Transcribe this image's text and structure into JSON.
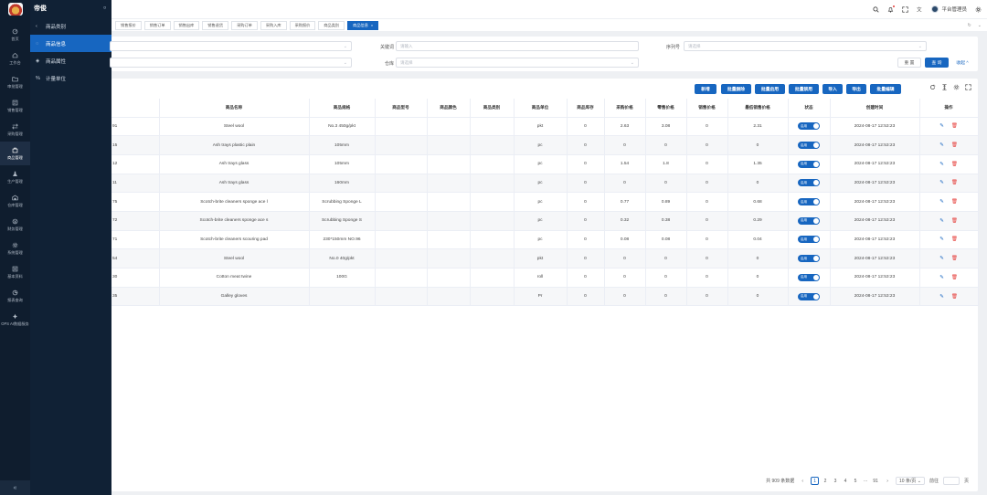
{
  "app": {
    "name": "帝俊",
    "pin": "¤"
  },
  "rail": {
    "items": [
      {
        "label": "首页",
        "icon": "dashboard-icon"
      },
      {
        "label": "工作台",
        "icon": "home-icon"
      },
      {
        "label": "审批管理",
        "icon": "folder-icon"
      },
      {
        "label": "销售管理",
        "icon": "sales-icon"
      },
      {
        "label": "采购管理",
        "icon": "purchase-icon"
      },
      {
        "label": "商品管理",
        "icon": "box-icon"
      },
      {
        "label": "生产管理",
        "icon": "flask-icon"
      },
      {
        "label": "仓库管理",
        "icon": "warehouse-icon"
      },
      {
        "label": "财务管理",
        "icon": "finance-icon"
      },
      {
        "label": "系统管理",
        "icon": "gear-icon"
      },
      {
        "label": "基本资料",
        "icon": "list-icon"
      },
      {
        "label": "报表查询",
        "icon": "report-icon"
      },
      {
        "label": "OPS AI数据服务",
        "icon": "ai-icon"
      }
    ],
    "collapse": "«"
  },
  "submenu": {
    "items": [
      {
        "label": "商品类别",
        "icon": "‹"
      },
      {
        "label": "商品信息",
        "icon": "◌"
      },
      {
        "label": "商品属性",
        "icon": "◈"
      },
      {
        "label": "计量单位",
        "icon": "%"
      }
    ]
  },
  "topbar": {
    "user": "平台管理员"
  },
  "tabs": {
    "items": [
      "销售报价",
      "销售订单",
      "销售出库",
      "销售退货",
      "采购订单",
      "采购入库",
      "采购报价",
      "商品类别",
      "商品信息"
    ],
    "close": "×",
    "refresh": "↻",
    "more": "⌄"
  },
  "filter": {
    "keyword_label": "关键词",
    "keyword_placeholder": "请输入",
    "serial_label": "序列号",
    "serial_placeholder": "请选择",
    "warehouse_label": "仓库",
    "warehouse_placeholder": "请选择",
    "reset": "重 置",
    "query": "查 询",
    "collapse": "收起 ^"
  },
  "toolbar": {
    "buttons": [
      "新增",
      "批量删除",
      "批量启用",
      "批量禁用",
      "导入",
      "导出",
      "批量编辑"
    ]
  },
  "table": {
    "headers": [
      "商品名称",
      "商品规格",
      "商品型号",
      "商品颜色",
      "商品类别",
      "商品单位",
      "商品库存",
      "采购价格",
      "零售价格",
      "销售价格",
      "最低销售价格",
      "状态",
      "创建时间",
      "操作"
    ],
    "status_label": "启用",
    "rows": [
      {
        "code": "91",
        "name": "Steel wool",
        "spec": "No.3 450g/pkt",
        "unit": "pkt",
        "stock": "0",
        "purchase": "2.63",
        "retail": "3.08",
        "sale": "0",
        "min": "2.31",
        "created": "2024-08-17 12:53:23"
      },
      {
        "code": "15",
        "name": "Ash trays plastic plain",
        "spec": "105mm",
        "unit": "pc",
        "stock": "0",
        "purchase": "0",
        "retail": "0",
        "sale": "0",
        "min": "0",
        "created": "2024-08-17 12:53:23"
      },
      {
        "code": "12",
        "name": "Ash trays glass",
        "spec": "105mm",
        "unit": "pc",
        "stock": "0",
        "purchase": "1.54",
        "retail": "1.8",
        "sale": "0",
        "min": "1.35",
        "created": "2024-08-17 12:53:23"
      },
      {
        "code": "11",
        "name": "Ash trays glass",
        "spec": "160mm",
        "unit": "pc",
        "stock": "0",
        "purchase": "0",
        "retail": "0",
        "sale": "0",
        "min": "0",
        "created": "2024-08-17 12:53:23"
      },
      {
        "code": "75",
        "name": "Scotch-brite cleaners sponge ace l",
        "spec": "Scrubbing Sponge L",
        "unit": "pc",
        "stock": "0",
        "purchase": "0.77",
        "retail": "0.89",
        "sale": "0",
        "min": "0.68",
        "created": "2024-08-17 12:53:23"
      },
      {
        "code": "72",
        "name": "Scotch-brite cleaners sponge ace s",
        "spec": "Scrubbing Sponge S",
        "unit": "pc",
        "stock": "0",
        "purchase": "0.32",
        "retail": "0.38",
        "sale": "0",
        "min": "0.29",
        "created": "2024-08-17 12:53:23"
      },
      {
        "code": "71",
        "name": "Scotch-brite cleaners scouring pad",
        "spec": "230*150mm NO.96",
        "unit": "pc",
        "stock": "0",
        "purchase": "0.08",
        "retail": "0.08",
        "sale": "0",
        "min": "0.04",
        "created": "2024-08-17 12:53:23"
      },
      {
        "code": "54",
        "name": "Steel wool",
        "spec": "No.0 40g/pkt",
        "unit": "pkt",
        "stock": "0",
        "purchase": "0",
        "retail": "0",
        "sale": "0",
        "min": "0",
        "created": "2024-08-17 12:53:23"
      },
      {
        "code": "30",
        "name": "Cotton meat twine",
        "spec": "100G",
        "unit": "roll",
        "stock": "0",
        "purchase": "0",
        "retail": "0",
        "sale": "0",
        "min": "0",
        "created": "2024-08-17 12:53:23"
      },
      {
        "code": "35",
        "name": "Galley gloves",
        "spec": "",
        "unit": "Pr",
        "stock": "0",
        "purchase": "0",
        "retail": "0",
        "sale": "0",
        "min": "0",
        "created": "2024-08-17 12:53:23"
      }
    ]
  },
  "pagination": {
    "total": "共 909 条数据",
    "pages": [
      "1",
      "2",
      "3",
      "4",
      "5",
      "···",
      "91"
    ],
    "prev": "‹",
    "next": "›",
    "size": "10 条/页",
    "size_chev": "⌄",
    "jump": "前往",
    "page_unit": "页"
  },
  "colors": {
    "primary": "#1766c0",
    "sidebar": "#0f1d2e",
    "danger": "#e53935"
  }
}
